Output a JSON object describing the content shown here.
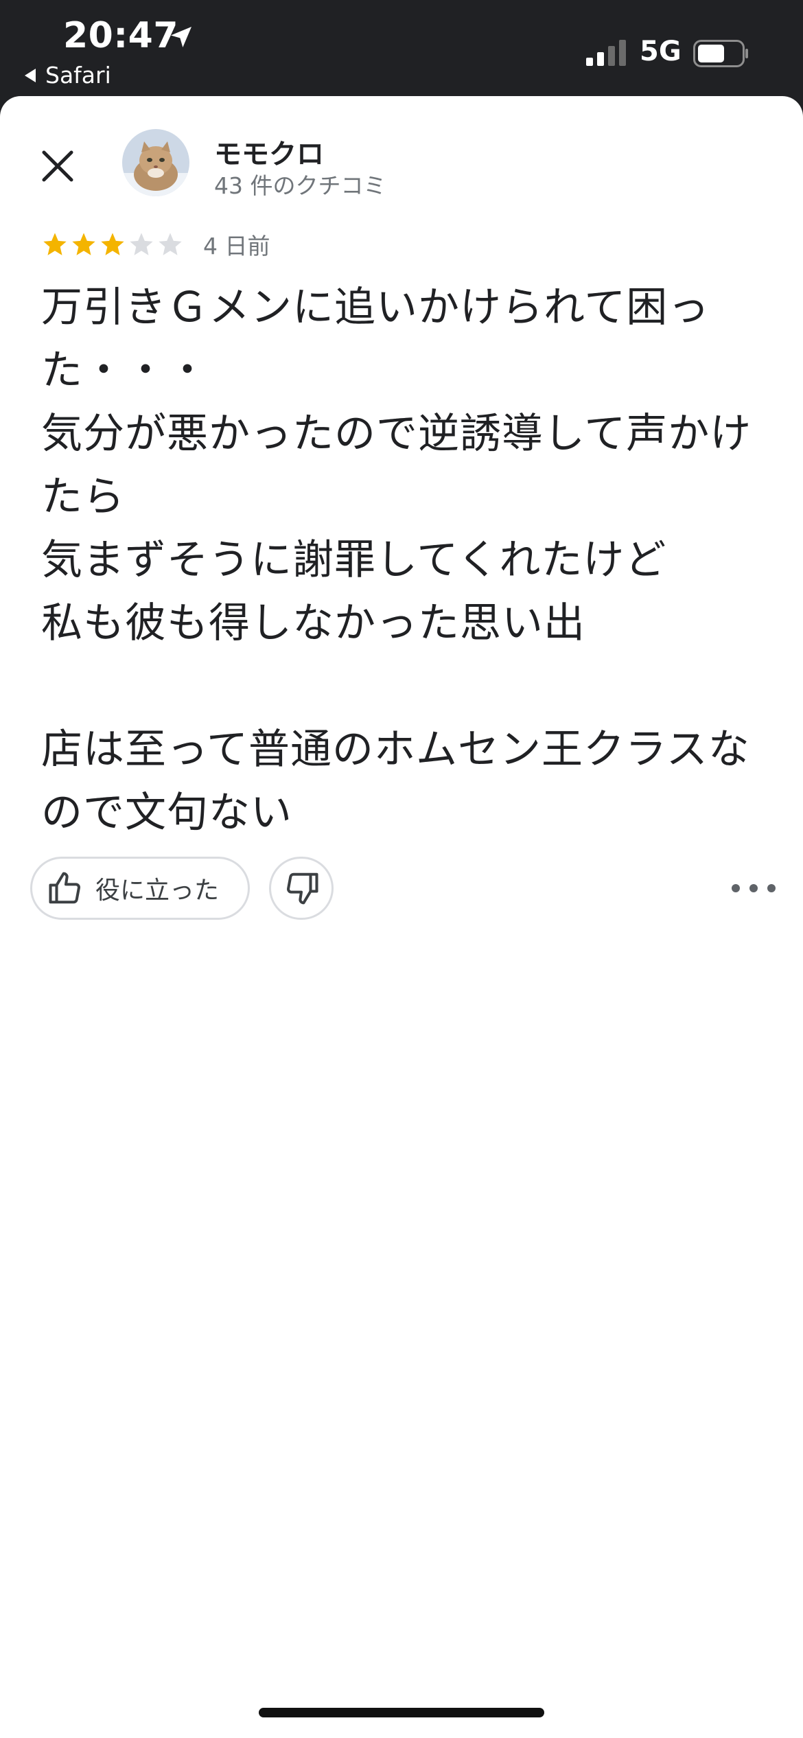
{
  "status_bar": {
    "time": "20:47",
    "back_app": "Safari",
    "network": "5G",
    "icons": [
      "location-arrow-icon",
      "cellular-signal-icon",
      "battery-icon"
    ]
  },
  "review": {
    "author": {
      "name": "モモクロ",
      "meta": "43 件のクチコミ"
    },
    "rating": 3,
    "max_rating": 5,
    "date": "4 日前",
    "body": "万引きＧメンに追いかけられて困った・・・\n気分が悪かったので逆誘導して声かけたら\n気まずそうに謝罪してくれたけど\n私も彼も得しなかった思い出\n\n店は至って普通のホムセン王クラスなので文句ない"
  },
  "actions": {
    "helpful_label": "役に立った",
    "icons": [
      "thumbs-up-icon",
      "thumbs-down-icon",
      "more-options-icon",
      "close-icon"
    ]
  },
  "colors": {
    "star_filled": "#f4b400",
    "star_empty": "#dadce0",
    "status_bar_bg": "#202124",
    "text_primary": "#202124",
    "text_secondary": "#70757a"
  }
}
